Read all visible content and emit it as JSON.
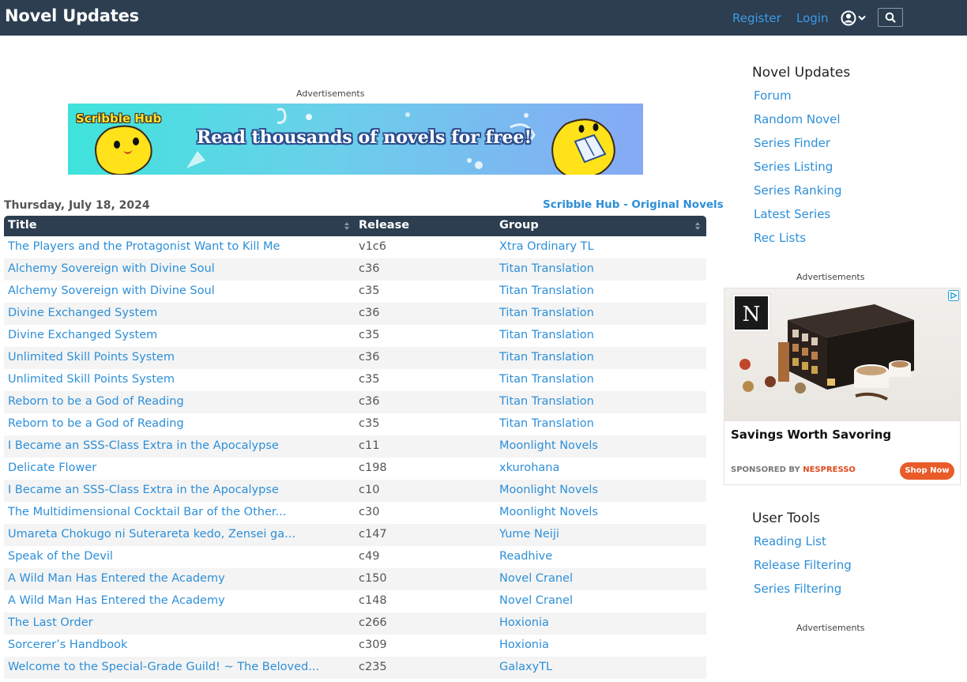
{
  "header": {
    "logo": "Novel Updates",
    "register": "Register",
    "login": "Login"
  },
  "ads": {
    "label": "Advertisements",
    "banner_logo": "Scribble Hub",
    "banner_tagline": "Read thousands of novels for free!",
    "side_headline": "Savings Worth Savoring",
    "side_sponsor_prefix": "SPONSORED BY ",
    "side_sponsor_brand": "NESPRESSO",
    "side_cta": "Shop Now",
    "side_logo_letter": "N"
  },
  "main": {
    "date": "Thursday, July 18, 2024",
    "promo_link": "Scribble Hub - Original Novels",
    "columns": [
      "Title",
      "Release",
      "Group"
    ],
    "rows": [
      {
        "title": "The Players and the Protagonist Want to Kill Me",
        "release": "v1c6",
        "group": "Xtra Ordinary TL"
      },
      {
        "title": "Alchemy Sovereign with Divine Soul",
        "release": "c36",
        "group": "Titan Translation"
      },
      {
        "title": "Alchemy Sovereign with Divine Soul",
        "release": "c35",
        "group": "Titan Translation"
      },
      {
        "title": "Divine Exchanged System",
        "release": "c36",
        "group": "Titan Translation"
      },
      {
        "title": "Divine Exchanged System",
        "release": "c35",
        "group": "Titan Translation"
      },
      {
        "title": "Unlimited Skill Points System",
        "release": "c36",
        "group": "Titan Translation"
      },
      {
        "title": "Unlimited Skill Points System",
        "release": "c35",
        "group": "Titan Translation"
      },
      {
        "title": "Reborn to be a God of Reading",
        "release": "c36",
        "group": "Titan Translation"
      },
      {
        "title": "Reborn to be a God of Reading",
        "release": "c35",
        "group": "Titan Translation"
      },
      {
        "title": "I Became an SSS-Class Extra in the Apocalypse",
        "release": "c11",
        "group": "Moonlight Novels"
      },
      {
        "title": "Delicate Flower",
        "release": "c198",
        "group": "xkurohana"
      },
      {
        "title": "I Became an SSS-Class Extra in the Apocalypse",
        "release": "c10",
        "group": "Moonlight Novels"
      },
      {
        "title": "The Multidimensional Cocktail Bar of the Other...",
        "release": "c30",
        "group": "Moonlight Novels"
      },
      {
        "title": "Umareta Chokugo ni Suterareta kedo, Zensei ga...",
        "release": "c147",
        "group": "Yume Neiji"
      },
      {
        "title": "Speak of the Devil",
        "release": "c49",
        "group": "Readhive"
      },
      {
        "title": "A Wild Man Has Entered the Academy",
        "release": "c150",
        "group": "Novel Cranel"
      },
      {
        "title": "A Wild Man Has Entered the Academy",
        "release": "c148",
        "group": "Novel Cranel"
      },
      {
        "title": "The Last Order",
        "release": "c266",
        "group": "Hoxionia"
      },
      {
        "title": "Sorcerer’s Handbook",
        "release": "c309",
        "group": "Hoxionia"
      },
      {
        "title": "Welcome to the Special-Grade Guild! ~ The Beloved...",
        "release": "c235",
        "group": "GalaxyTL"
      }
    ]
  },
  "sidebar": {
    "section1_title": "Novel Updates",
    "links1": [
      "Forum",
      "Random Novel",
      "Series Finder",
      "Series Listing",
      "Series Ranking",
      "Latest Series",
      "Rec Lists"
    ],
    "section2_title": "User Tools",
    "links2": [
      "Reading List",
      "Release Filtering",
      "Series Filtering"
    ]
  }
}
